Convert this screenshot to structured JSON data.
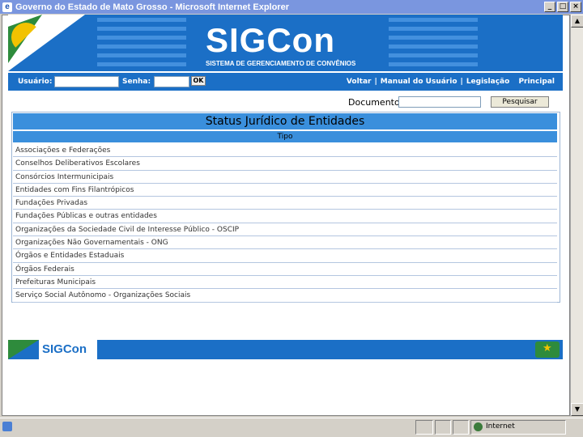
{
  "window": {
    "title": "Governo do Estado de Mato Grosso - Microsoft Internet Explorer",
    "buttons": [
      "_",
      "□",
      "×"
    ]
  },
  "banner": {
    "logo": "SIGCon",
    "subtitle": "SISTEMA DE GERENCIAMENTO DE CONVÊNIOS"
  },
  "login": {
    "user_label": "Usuário:",
    "password_label": "Senha:",
    "ok_label": "OK"
  },
  "nav": {
    "links": [
      "Voltar",
      "Manual do Usuário",
      "Legislação",
      "Principal"
    ]
  },
  "search": {
    "label": "Documento",
    "button": "Pesquisar"
  },
  "table": {
    "title": "Status Jurídico de Entidades",
    "column": "Tipo",
    "rows": [
      "Associações e Federações",
      "Conselhos Deliberativos Escolares",
      "Consórcios Intermunicipais",
      "Entidades com Fins Filantrópicos",
      "Fundações Privadas",
      "Fundações Públicas e outras entidades",
      "Organizações da Sociedade Civil de Interesse Público - OSCIP",
      "Organizações Não Governamentais - ONG",
      "Órgãos e Entidades Estaduais",
      "Órgãos Federais",
      "Prefeituras Municipais",
      "Serviço Social Autônomo - Organizações Sociais"
    ]
  },
  "footer": {
    "logo": "SIGCon"
  },
  "status": {
    "zone": "Internet"
  },
  "colors": {
    "brand_blue": "#1b6fc6",
    "header_blue": "#3a8fdc",
    "green": "#2e8b3c",
    "yellow": "#f2c200"
  }
}
